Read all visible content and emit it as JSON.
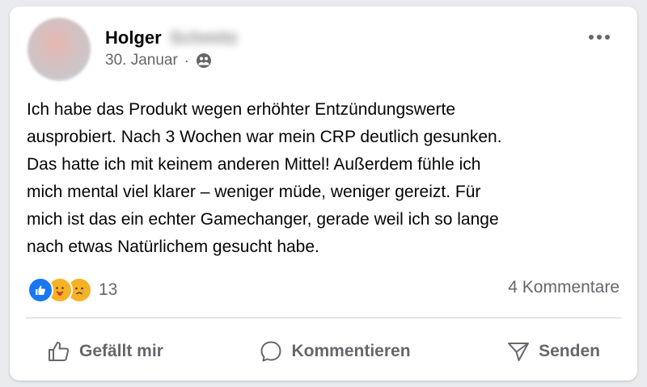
{
  "post": {
    "author_first_name": "Holger",
    "author_last_name": "Schmitz",
    "date": "30. Januar",
    "separator": "·",
    "audience_icon": "friends-icon",
    "text": "Ich habe das Produkt wegen erhöhter Entzündungswerte\nausprobiert. Nach 3 Wochen war mein CRP deutlich gesunken.\nDas hatte ich mit keinem anderen Mittel! Außerdem fühle ich\nmich mental viel klarer – weniger müde, weniger gereizt. Für\nmich ist das ein echter Gamechanger, gerade weil ich so lange\nnach etwas Natürlichem gesucht habe."
  },
  "reactions": {
    "icons": [
      "like-icon",
      "care-icon",
      "sad-icon"
    ],
    "count": "13"
  },
  "comments": {
    "label": "4 Kommentare"
  },
  "actions": {
    "like_label": "Gefällt mir",
    "comment_label": "Kommentieren",
    "share_label": "Senden"
  },
  "colors": {
    "accent": "#1877f2",
    "secondary_text": "#65676b",
    "primary_text": "#050505",
    "reaction_yellow": "#f7b125"
  }
}
